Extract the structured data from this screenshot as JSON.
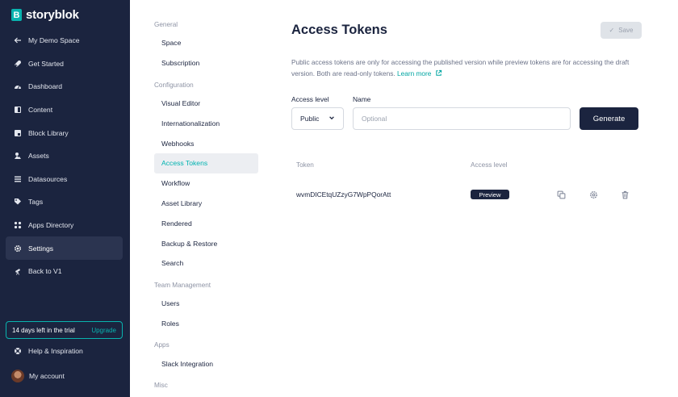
{
  "brand": {
    "mark": "B",
    "name": "storyblok"
  },
  "sidebar": {
    "items": [
      {
        "label": "My Demo Space",
        "icon": "arrow-left-icon",
        "active": false
      },
      {
        "label": "Get Started",
        "icon": "rocket-icon",
        "active": false
      },
      {
        "label": "Dashboard",
        "icon": "gauge-icon",
        "active": false
      },
      {
        "label": "Content",
        "icon": "content-icon",
        "active": false
      },
      {
        "label": "Block Library",
        "icon": "blocks-icon",
        "active": false
      },
      {
        "label": "Assets",
        "icon": "assets-icon",
        "active": false
      },
      {
        "label": "Datasources",
        "icon": "datasources-icon",
        "active": false
      },
      {
        "label": "Tags",
        "icon": "tag-icon",
        "active": false
      },
      {
        "label": "Apps Directory",
        "icon": "apps-icon",
        "active": false
      },
      {
        "label": "Settings",
        "icon": "gear-icon",
        "active": true
      },
      {
        "label": "Back to V1",
        "icon": "telescope-icon",
        "active": false
      }
    ],
    "trial": {
      "text": "14 days left in the trial",
      "link": "Upgrade"
    },
    "help": "Help & Inspiration",
    "account": "My account"
  },
  "settings_menu": {
    "sections": [
      {
        "title": "General",
        "items": [
          "Space",
          "Subscription"
        ]
      },
      {
        "title": "Configuration",
        "items": [
          "Visual Editor",
          "Internationalization",
          "Webhooks",
          "Access Tokens",
          "Workflow",
          "Asset Library",
          "Rendered",
          "Backup & Restore",
          "Search"
        ]
      },
      {
        "title": "Team Management",
        "items": [
          "Users",
          "Roles"
        ]
      },
      {
        "title": "Apps",
        "items": [
          "Slack Integration"
        ]
      },
      {
        "title": "Misc",
        "items": []
      }
    ],
    "active": "Access Tokens"
  },
  "main": {
    "title": "Access Tokens",
    "save_label": "Save",
    "description": "Public access tokens are only for accessing the published version while preview tokens are for accessing the draft version. Both are read-only tokens.",
    "learn_more": "Learn more",
    "access_level_label": "Access level",
    "access_level_value": "Public",
    "name_label": "Name",
    "name_placeholder": "Optional",
    "generate_label": "Generate",
    "table": {
      "headers": [
        "Token",
        "Access level"
      ],
      "rows": [
        {
          "token": "wvmDICEtqUZzyG7WpPQorAtt",
          "access": "Preview"
        }
      ]
    }
  },
  "colors": {
    "sidebar_bg": "#1b243f",
    "accent": "#09b3af",
    "active_text": "#00b3b0"
  }
}
